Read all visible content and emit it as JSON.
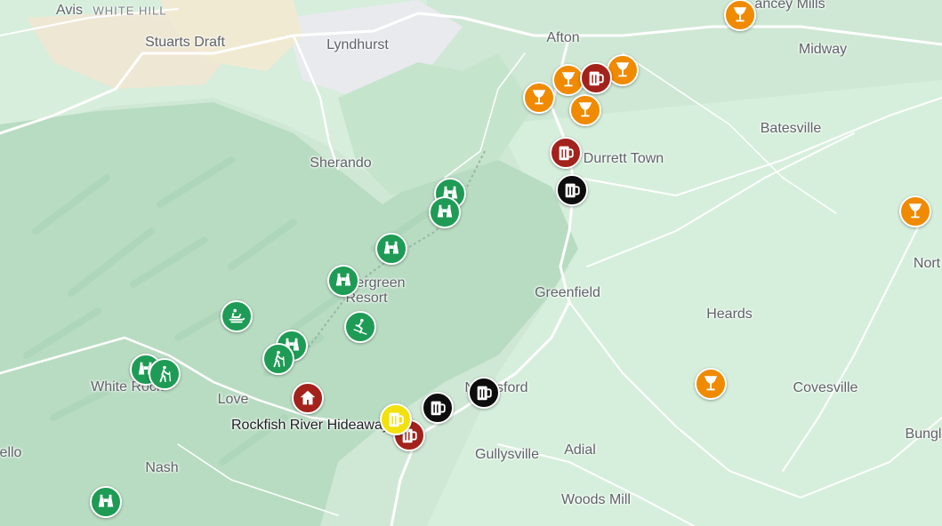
{
  "place_labels": [
    {
      "name": "avis-label",
      "text": "Avis"
    },
    {
      "name": "white-hill-label",
      "text": "WHITE HILL"
    },
    {
      "name": "stuarts-draft-label",
      "text": "Stuarts Draft"
    },
    {
      "name": "lyndhurst-label",
      "text": "Lyndhurst"
    },
    {
      "name": "afton-label",
      "text": "Afton"
    },
    {
      "name": "yancey-mills-label",
      "text": "ancey Mills"
    },
    {
      "name": "midway-label",
      "text": "Midway"
    },
    {
      "name": "batesville-label",
      "text": "Batesville"
    },
    {
      "name": "sherando-label",
      "text": "Sherando"
    },
    {
      "name": "durrett-town-label",
      "text": "Durrett Town"
    },
    {
      "name": "wintergreen-resort-label",
      "text": "Wintergreen Resort"
    },
    {
      "name": "greenfield-label",
      "text": "Greenfield"
    },
    {
      "name": "heards-label",
      "text": "Heards"
    },
    {
      "name": "north-label",
      "text": "Nort"
    },
    {
      "name": "white-rock-label",
      "text": "White Rock"
    },
    {
      "name": "love-label",
      "text": "Love"
    },
    {
      "name": "nellysford-label",
      "text": "Nellysford"
    },
    {
      "name": "covesville-label",
      "text": "Covesville"
    },
    {
      "name": "bungle-label",
      "text": "Bungl"
    },
    {
      "name": "ello-label",
      "text": "ello"
    },
    {
      "name": "nash-label",
      "text": "Nash"
    },
    {
      "name": "gullysville-label",
      "text": "Gullysville"
    },
    {
      "name": "adial-label",
      "text": "Adial"
    },
    {
      "name": "woods-mill-label",
      "text": "Woods Mill"
    }
  ],
  "poi_label": "Rockfish River Hideaway",
  "markers": [
    {
      "name": "winery-marker",
      "icon": "wine-glass-icon",
      "color": "orange"
    },
    {
      "name": "winery-marker",
      "icon": "wine-glass-icon",
      "color": "orange"
    },
    {
      "name": "winery-marker",
      "icon": "wine-glass-icon",
      "color": "orange"
    },
    {
      "name": "winery-marker",
      "icon": "wine-glass-icon",
      "color": "orange"
    },
    {
      "name": "winery-marker",
      "icon": "wine-glass-icon",
      "color": "orange"
    },
    {
      "name": "winery-marker",
      "icon": "wine-glass-icon",
      "color": "orange"
    },
    {
      "name": "winery-marker",
      "icon": "wine-glass-icon",
      "color": "orange"
    },
    {
      "name": "brewery-marker",
      "icon": "beer-mug-icon",
      "color": "red"
    },
    {
      "name": "brewery-marker",
      "icon": "beer-mug-icon",
      "color": "red"
    },
    {
      "name": "brewery-marker",
      "icon": "beer-mug-icon",
      "color": "red"
    },
    {
      "name": "distillery-marker",
      "icon": "beer-mug-icon",
      "color": "black"
    },
    {
      "name": "distillery-marker",
      "icon": "beer-mug-icon",
      "color": "black"
    },
    {
      "name": "distillery-marker",
      "icon": "beer-mug-icon",
      "color": "black"
    },
    {
      "name": "cidery-marker",
      "icon": "beer-mug-icon",
      "color": "yellow"
    },
    {
      "name": "viewpoint-marker",
      "icon": "binoculars-icon",
      "color": "green"
    },
    {
      "name": "viewpoint-marker",
      "icon": "binoculars-icon",
      "color": "green"
    },
    {
      "name": "viewpoint-marker",
      "icon": "binoculars-icon",
      "color": "green"
    },
    {
      "name": "viewpoint-marker",
      "icon": "binoculars-icon",
      "color": "green"
    },
    {
      "name": "viewpoint-marker",
      "icon": "binoculars-icon",
      "color": "green"
    },
    {
      "name": "viewpoint-marker",
      "icon": "binoculars-icon",
      "color": "green"
    },
    {
      "name": "viewpoint-marker",
      "icon": "binoculars-icon",
      "color": "green"
    },
    {
      "name": "hiking-marker",
      "icon": "hiker-icon",
      "color": "green"
    },
    {
      "name": "hiking-marker",
      "icon": "hiker-icon",
      "color": "green"
    },
    {
      "name": "sledding-marker",
      "icon": "sled-icon",
      "color": "green"
    },
    {
      "name": "skiing-marker",
      "icon": "skier-icon",
      "color": "green"
    },
    {
      "name": "home-marker",
      "icon": "house-icon",
      "color": "red"
    }
  ]
}
